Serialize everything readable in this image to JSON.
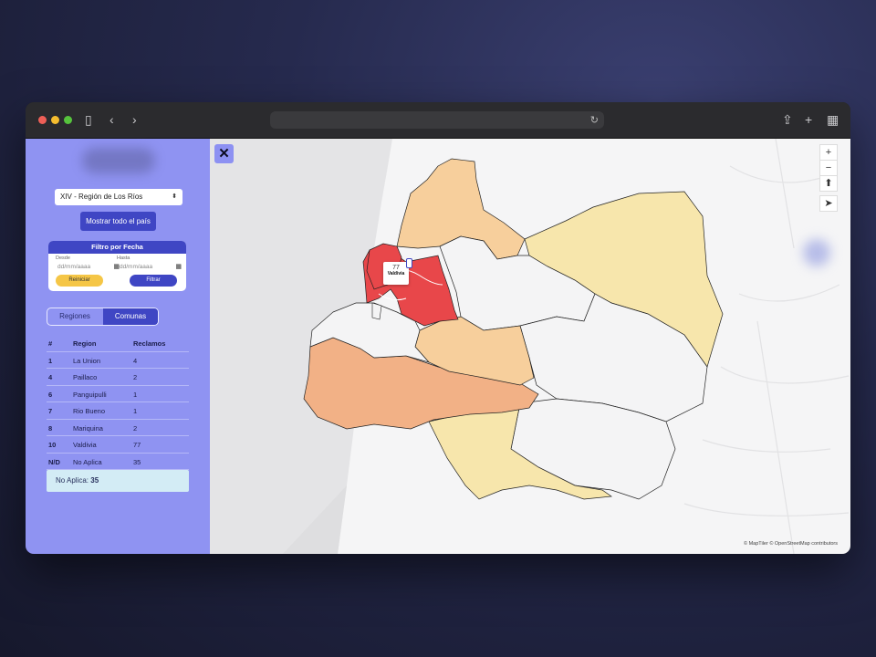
{
  "sidebar": {
    "region_select": "XIV - Región de Los Ríos",
    "show_all_button": "Mostrar todo el país",
    "date_filter": {
      "title": "Filtro por Fecha",
      "from_label": "Desde",
      "to_label": "Hasta",
      "from_placeholder": "dd/mm/aaaa",
      "to_placeholder": "dd/mm/aaaa",
      "reset_button": "Reiniciar",
      "filter_button": "Filtrar"
    },
    "tabs": [
      "Regiones",
      "Comunas"
    ],
    "active_tab": "Comunas",
    "table": {
      "headers": [
        "#",
        "Region",
        "Reclamos"
      ],
      "rows": [
        [
          "1",
          "La Union",
          "4"
        ],
        [
          "4",
          "Paillaco",
          "2"
        ],
        [
          "6",
          "Panguipulli",
          "1"
        ],
        [
          "7",
          "Rio Bueno",
          "1"
        ],
        [
          "8",
          "Mariquina",
          "2"
        ],
        [
          "10",
          "Valdivia",
          "77"
        ],
        [
          "N/D",
          "No Aplica",
          "35"
        ]
      ]
    },
    "summary_label": "No Aplica:",
    "summary_value": "35"
  },
  "map": {
    "popup_value": "77",
    "popup_name": "Valdivia",
    "attribution": "© MapTiler © OpenStreetMap contributors",
    "close_icon": "x-icon",
    "colors": {
      "high": "#e8474a",
      "mid": "#f2b186",
      "low_mid": "#f7cf9c",
      "low": "#f7e6ac",
      "none": "#f4f4f5"
    }
  }
}
